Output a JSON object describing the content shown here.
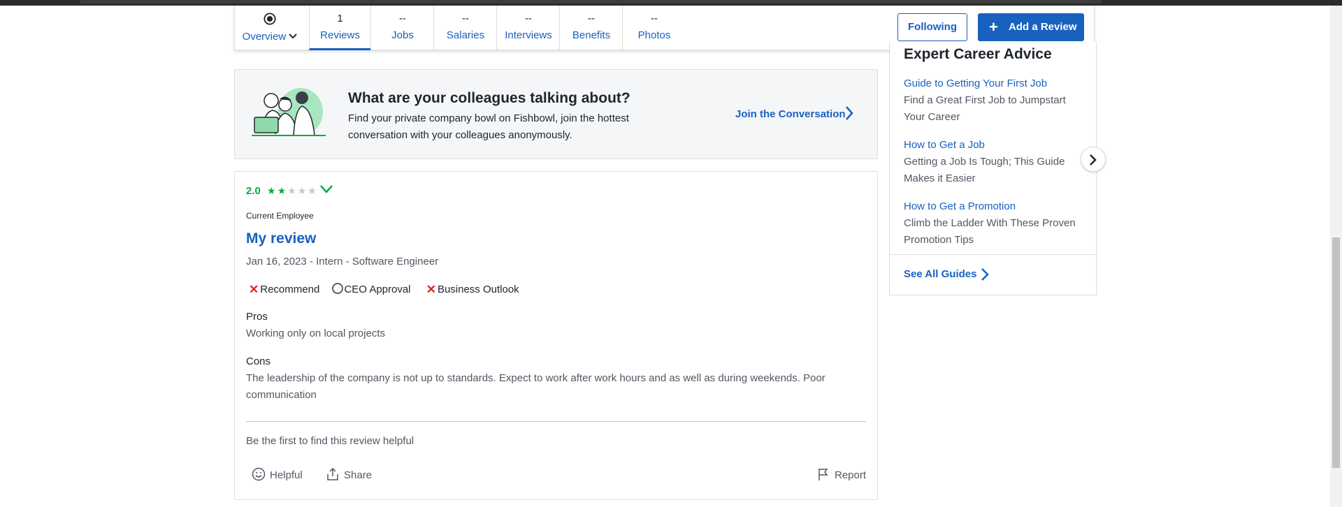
{
  "nav": {
    "overview_label": "Overview",
    "tabs": [
      {
        "count": "1",
        "label": "Reviews"
      },
      {
        "count": "--",
        "label": "Jobs"
      },
      {
        "count": "--",
        "label": "Salaries"
      },
      {
        "count": "--",
        "label": "Interviews"
      },
      {
        "count": "--",
        "label": "Benefits"
      },
      {
        "count": "--",
        "label": "Photos"
      }
    ],
    "following_label": "Following",
    "add_review_label": "Add a Review"
  },
  "promo": {
    "title": "What are your colleagues talking about?",
    "description": "Find your private company bowl on Fishbowl, join the hottest conversation with your colleagues anonymously.",
    "cta": "Join the Conversation"
  },
  "review": {
    "rating": "2.0",
    "stars_filled": 2,
    "stars_total": 5,
    "employment_status": "Current Employee",
    "title": "My review",
    "meta": "Jan 16, 2023 - Intern - Software Engineer",
    "ratings": {
      "recommend": "Recommend",
      "ceo_approval": "CEO Approval",
      "business_outlook": "Business Outlook"
    },
    "pros_label": "Pros",
    "pros_text": "Working only on local projects",
    "cons_label": "Cons",
    "cons_text": "The leadership of the company is not up to standards. Expect to work after work hours and as well as during weekends. Poor communication",
    "helpful_note": "Be the first to find this review helpful",
    "actions": {
      "helpful": "Helpful",
      "share": "Share",
      "report": "Report"
    }
  },
  "sidebar": {
    "heading": "Expert Career Advice",
    "guides": [
      {
        "title": "Guide to Getting Your First Job",
        "desc": "Find a Great First Job to Jumpstart Your Career"
      },
      {
        "title": "How to Get a Job",
        "desc": "Getting a Job Is Tough; This Guide Makes it Easier"
      },
      {
        "title": "How to Get a Promotion",
        "desc": "Climb the Ladder With These Proven Promotion Tips"
      }
    ],
    "see_all": "See All Guides"
  },
  "colors": {
    "link_blue": "#1861bf",
    "rating_green": "#0caa41",
    "negative_red": "#e0201f"
  }
}
